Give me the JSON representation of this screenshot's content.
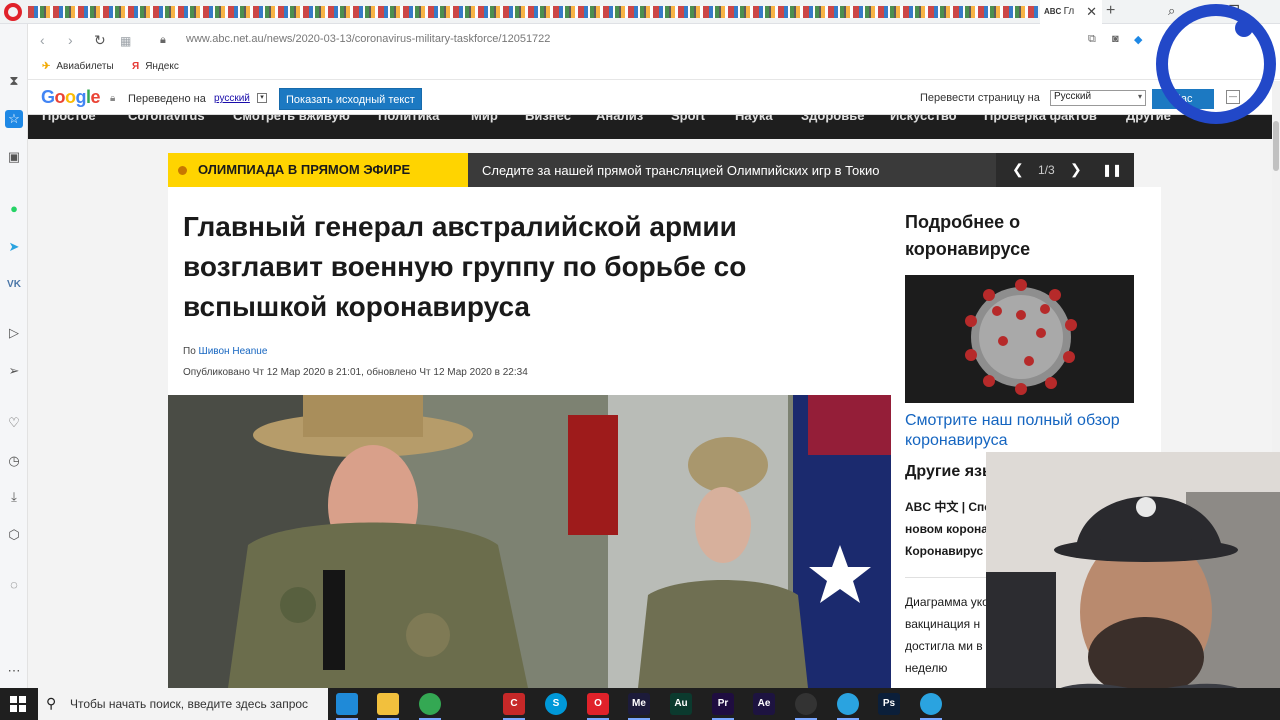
{
  "browser": {
    "active_tab_label": "Гл",
    "url_prefix": "www.abc.net.au",
    "url_path": "/news/2020-03-13/coronavirus-military-taskforce/12051722",
    "bookmarks": [
      {
        "icon": "airplane-icon",
        "label": "Авиабилеты"
      },
      {
        "icon": "yandex-icon",
        "label": "Яндекс"
      }
    ]
  },
  "translate_bar": {
    "logo": "Google",
    "translated_to_label": "Переведено на",
    "language": "русский",
    "show_original_button": "Показать исходный текст",
    "translate_page_label": "Перевести страницу на",
    "selected_language": "Русский",
    "go_button": "Час"
  },
  "site_nav": [
    "Простое",
    "Coronavirus",
    "Смотреть вживую",
    "Политика",
    "Мир",
    "Бизнес",
    "Анализ",
    "Sport",
    "Наука",
    "Здоровье",
    "Искусство",
    "Проверка фактов",
    "Другие"
  ],
  "live_banner": {
    "title": "ОЛИМПИАДА В ПРЯМОМ ЭФИРЕ",
    "text": "Следите за нашей прямой трансляцией Олимпийских игр в Токио",
    "counter": "1/3"
  },
  "article": {
    "headline": "Главный генерал австралийской армии возглавит военную группу по борьбе со вспышкой коронавируса",
    "by_prefix": "По",
    "author": "Шивон Heanue",
    "published": "Опубликовано Чт 12 Мар 2020 в 21:01, обновлено Чт 12 Мар 2020 в 22:34"
  },
  "sidebar": {
    "heading": "Подробнее о коронавирусе",
    "overview_link": "Смотрите наш полный обзор коронавируса",
    "other_languages_heading": "Другие языки",
    "lang_line1_prefix": "ABC 中文",
    "lang_line1_rest": "| Специальный отч",
    "lang_line2": "новом коронавирусе",
    "lang_line3": "Коронавирус пандемия",
    "news_item": "Диаграмма уколо вакцинация н достигла ми в неделю"
  },
  "taskbar": {
    "search_placeholder": "Чтобы начать поиск, введите здесь запрос",
    "apps": [
      {
        "icon": "edge-icon",
        "label": "",
        "color": "#1f8ad8"
      },
      {
        "icon": "file-explorer-icon",
        "label": "",
        "color": "#f2c03d"
      },
      {
        "icon": "chrome-icon",
        "label": "",
        "color": "#34a853"
      },
      {
        "icon": "app-c-icon",
        "label": "C",
        "color": "#c62828"
      },
      {
        "icon": "skype-icon",
        "label": "S",
        "color": "#0098d8"
      },
      {
        "icon": "opera-icon",
        "label": "O",
        "color": "#e0222a"
      },
      {
        "icon": "media-encoder-icon",
        "label": "Me",
        "color": "#1c1b3a"
      },
      {
        "icon": "audition-icon",
        "label": "Au",
        "color": "#0b3a2e"
      },
      {
        "icon": "premiere-icon",
        "label": "Pr",
        "color": "#1f0d40"
      },
      {
        "icon": "after-effects-icon",
        "label": "Ae",
        "color": "#1d1340"
      },
      {
        "icon": "obs-icon",
        "label": "",
        "color": "#333333"
      },
      {
        "icon": "telegram-icon",
        "label": "",
        "color": "#2aa3e0"
      },
      {
        "icon": "photoshop-icon",
        "label": "Ps",
        "color": "#0b1f3a"
      },
      {
        "icon": "telegram-badge-icon",
        "label": "",
        "color": "#2aa3e0"
      }
    ]
  }
}
